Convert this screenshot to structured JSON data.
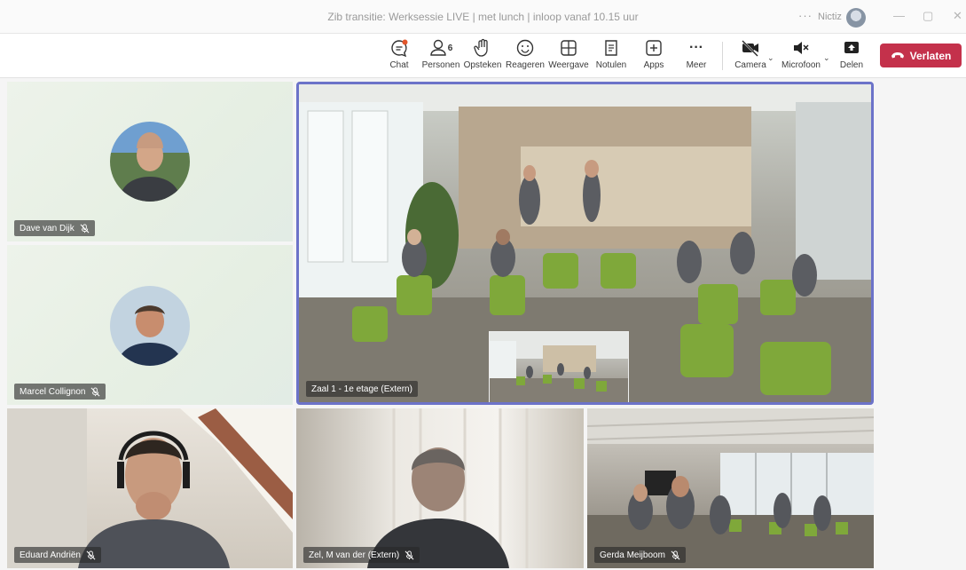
{
  "window": {
    "title": "Zib transitie: Werksessie LIVE | met lunch | inloop vanaf 10.15 uur",
    "more_dots": "···",
    "org": "Nictiz",
    "minimize": "—",
    "maximize": "▢",
    "close": "✕"
  },
  "toolbar": {
    "chat": "Chat",
    "people": "Personen",
    "people_count": "6",
    "raise": "Opsteken",
    "react": "Reageren",
    "view": "Weergave",
    "notes": "Notulen",
    "apps": "Apps",
    "more": "Meer",
    "more_dots": "···",
    "camera": "Camera",
    "mic": "Microfoon",
    "share": "Delen",
    "leave": "Verlaten"
  },
  "colors": {
    "leave": "#c4314b",
    "active_speaker_border": "#6c73c9",
    "chat_badge": "#e3562b"
  },
  "participants": [
    {
      "name": "Dave van Dijk",
      "muted": true,
      "video": false
    },
    {
      "name": "Marcel Collignon",
      "muted": true,
      "video": false
    },
    {
      "name": "Zaal 1 - 1e etage (Extern)",
      "muted": false,
      "video": true
    },
    {
      "name": "Eduard Andriën",
      "muted": true,
      "video": true
    },
    {
      "name": "Zel, M van der (Extern)",
      "muted": true,
      "video": true
    },
    {
      "name": "Gerda Meijboom",
      "muted": true,
      "video": true
    }
  ]
}
